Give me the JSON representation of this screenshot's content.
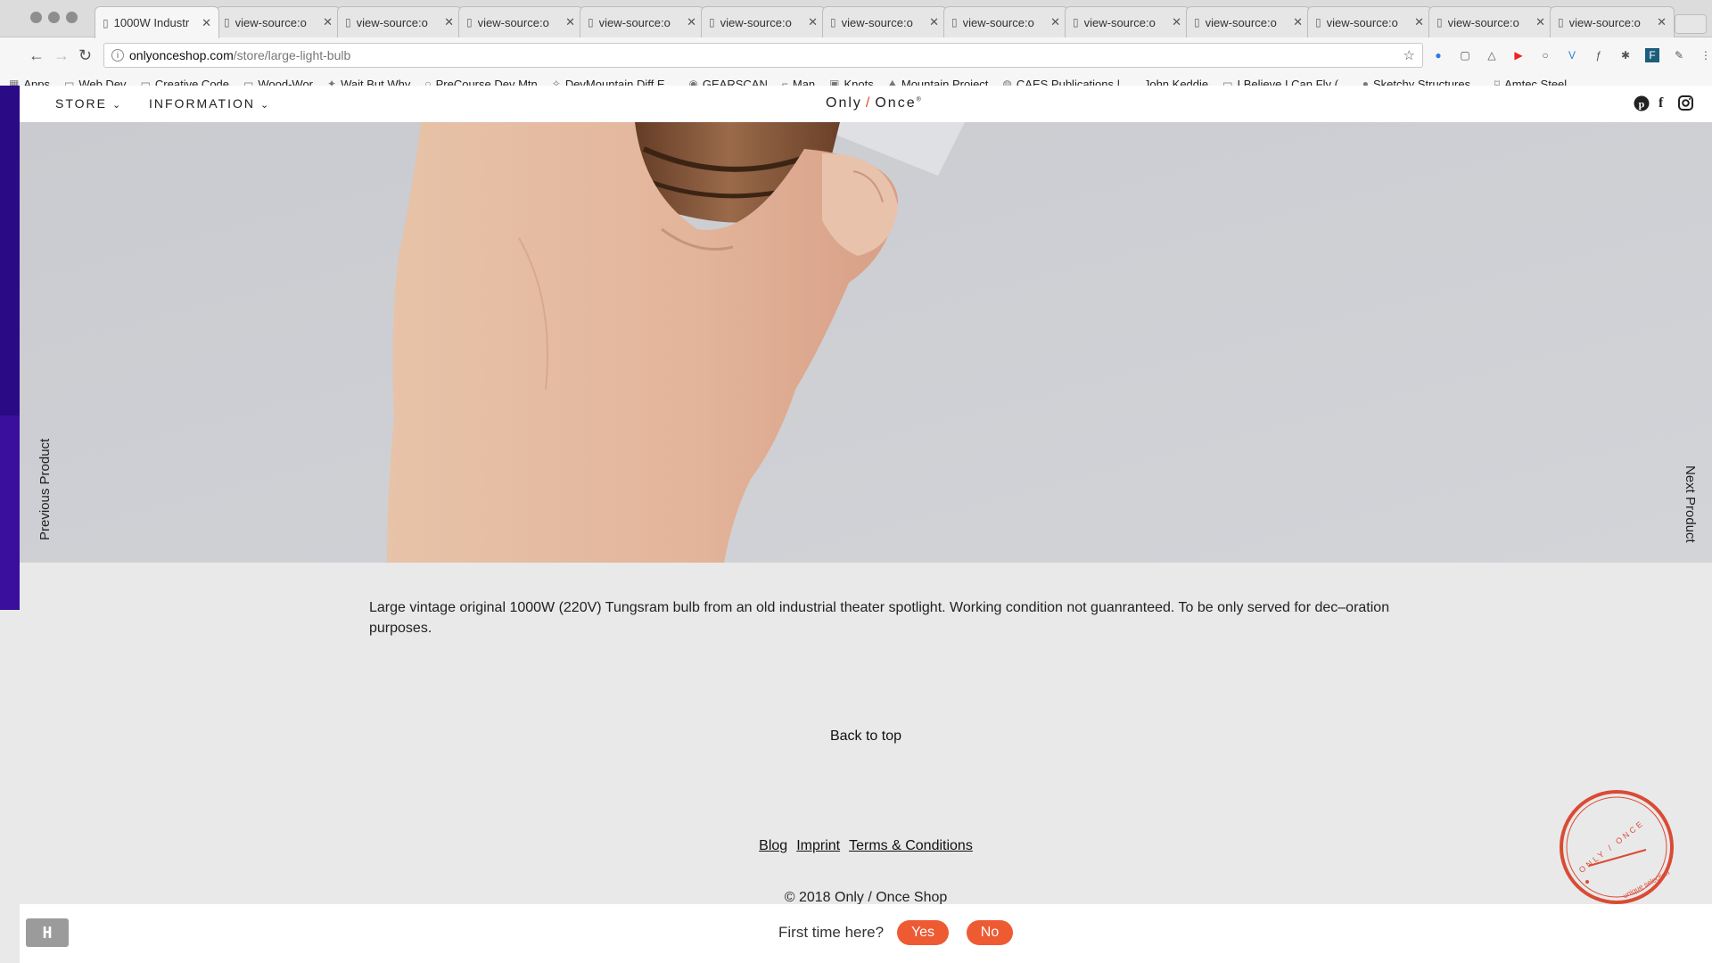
{
  "browser": {
    "tabs": [
      {
        "title": "1000W Industr",
        "active": true
      },
      {
        "title": "view-source:o"
      },
      {
        "title": "view-source:o"
      },
      {
        "title": "view-source:o"
      },
      {
        "title": "view-source:o"
      },
      {
        "title": "view-source:o"
      },
      {
        "title": "view-source:o"
      },
      {
        "title": "view-source:o"
      },
      {
        "title": "view-source:o"
      },
      {
        "title": "view-source:o"
      },
      {
        "title": "view-source:o"
      },
      {
        "title": "view-source:o"
      },
      {
        "title": "view-source:o"
      }
    ],
    "tab_close": "✕",
    "address": {
      "host": "onlyonceshop.com",
      "path": "/store/large-light-bulb"
    },
    "bookmarks": [
      "Apps",
      "Web Dev",
      "Creative Code",
      "Wood-Wor",
      "Wait But Why",
      "PreCourse Dev Mtn",
      "DevMountain Diff E...",
      "GEARSCAN",
      "Man",
      "Knots",
      "Mountain Project",
      "CAES Publications |...",
      "John Keddie",
      "I Believe I Can Fly (...",
      "Sketchy Structures...",
      "Amtec Steel"
    ]
  },
  "site": {
    "nav": {
      "store": "STORE",
      "information": "INFORMATION",
      "chevron": "⌄"
    },
    "logo": {
      "left": "Only",
      "slash": "/",
      "right": "Once",
      "mark": "®"
    },
    "social_icons": [
      "pinterest-icon",
      "facebook-icon",
      "instagram-icon"
    ],
    "previous_product": "Previous Product",
    "next_product": "Next Product",
    "description": "Large vintage original 1000W (220V) Tungsram bulb from an old industrial theater spotlight. Working condition not guanranteed. To be only served for dec–oration purposes.",
    "back_to_top": "Back to top",
    "footer_links": [
      "Blog",
      "Imprint",
      "Terms & Conditions"
    ],
    "copyright": "© 2018 Only / Once Shop",
    "stamp": {
      "top": "ONLY / ONCE",
      "bottom": "unique selection"
    },
    "prompt": {
      "question": "First time here?",
      "yes": "Yes",
      "no": "No"
    },
    "widget_label": "H",
    "accent_color": "#ee5b33"
  }
}
